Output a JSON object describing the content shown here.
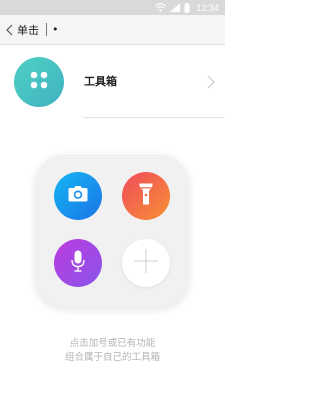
{
  "status_bar": {
    "time": "12:34",
    "icons": [
      "wifi-icon",
      "signal-icon",
      "battery-icon"
    ]
  },
  "title_bar": {
    "back_icon": "chevron-left-icon",
    "title": "单击",
    "dot": "•"
  },
  "toolbox_row": {
    "icon": "toolbox-dots-icon",
    "label": "工具箱",
    "chevron_icon": "chevron-right-icon"
  },
  "tools": [
    {
      "name": "camera",
      "icon": "camera-icon",
      "color": "#1b8fee"
    },
    {
      "name": "flashlight",
      "icon": "flashlight-icon",
      "color": "#f46b45"
    },
    {
      "name": "voice",
      "icon": "microphone-icon",
      "color": "#a348e6"
    },
    {
      "name": "add",
      "icon": "plus-icon",
      "color": "#ffffff"
    }
  ],
  "hint": {
    "line1": "点击加号或已有功能",
    "line2": "组合属于自己的工具箱"
  },
  "colors": {
    "status_bar": "#d9d9d9",
    "title_bar": "#f5f5f5",
    "toolbox_icon": "#46c3c2",
    "panel": "#f1f1f2",
    "hint_text": "#b3b3b3"
  }
}
